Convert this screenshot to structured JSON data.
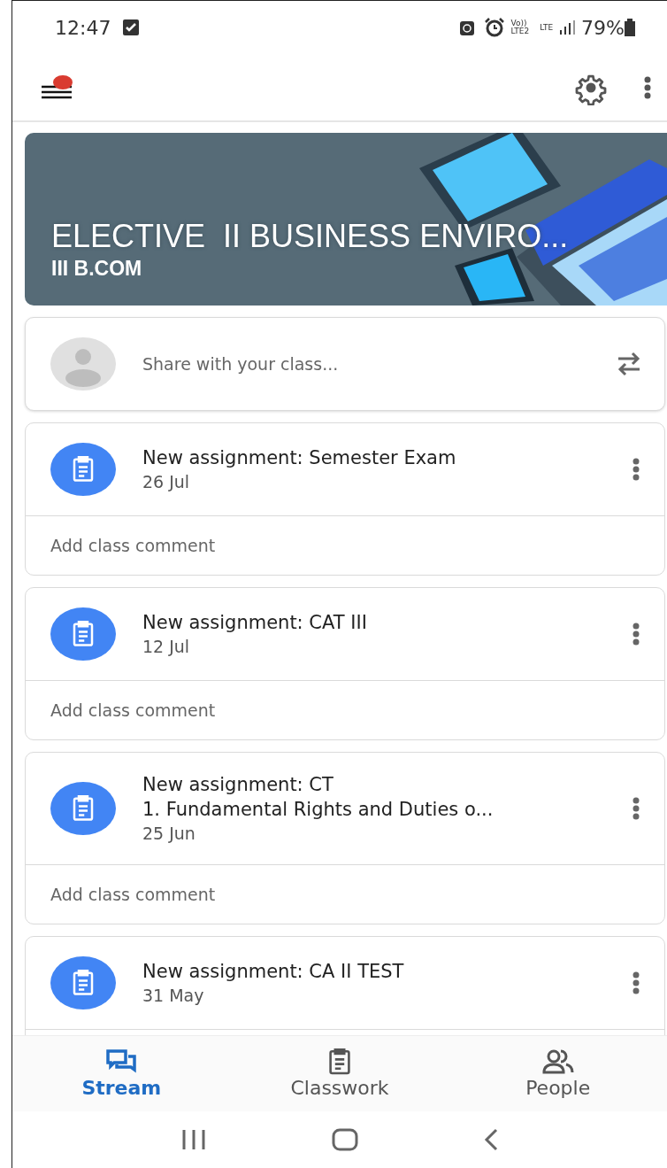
{
  "status_bar": {
    "time": "12:47",
    "volte_top": "Vo))",
    "volte_bottom": "LTE2",
    "network": "LTE",
    "battery": "79%"
  },
  "app_bar": {
    "notification_dot": true
  },
  "banner": {
    "title": "ELECTIVE  II BUSINESS ENVIRO...",
    "subtitle": "III B.COM"
  },
  "share": {
    "placeholder": "Share with your class..."
  },
  "posts": [
    {
      "title": "New assignment: Semester Exam",
      "date": "26 Jul",
      "comment_placeholder": "Add class comment"
    },
    {
      "title": "New assignment: CAT III",
      "date": "12 Jul",
      "comment_placeholder": "Add class comment"
    },
    {
      "title": "New assignment: CT",
      "detail": "1. Fundamental Rights and Duties o...",
      "date": "25 Jun",
      "comment_placeholder": "Add class comment"
    },
    {
      "title": "New assignment: CA II TEST",
      "date": "31 May"
    }
  ],
  "tabs": [
    {
      "label": "Stream",
      "kind": "stream",
      "selected": true
    },
    {
      "label": "Classwork",
      "kind": "classwork",
      "selected": false
    },
    {
      "label": "People",
      "kind": "people",
      "selected": false
    }
  ]
}
